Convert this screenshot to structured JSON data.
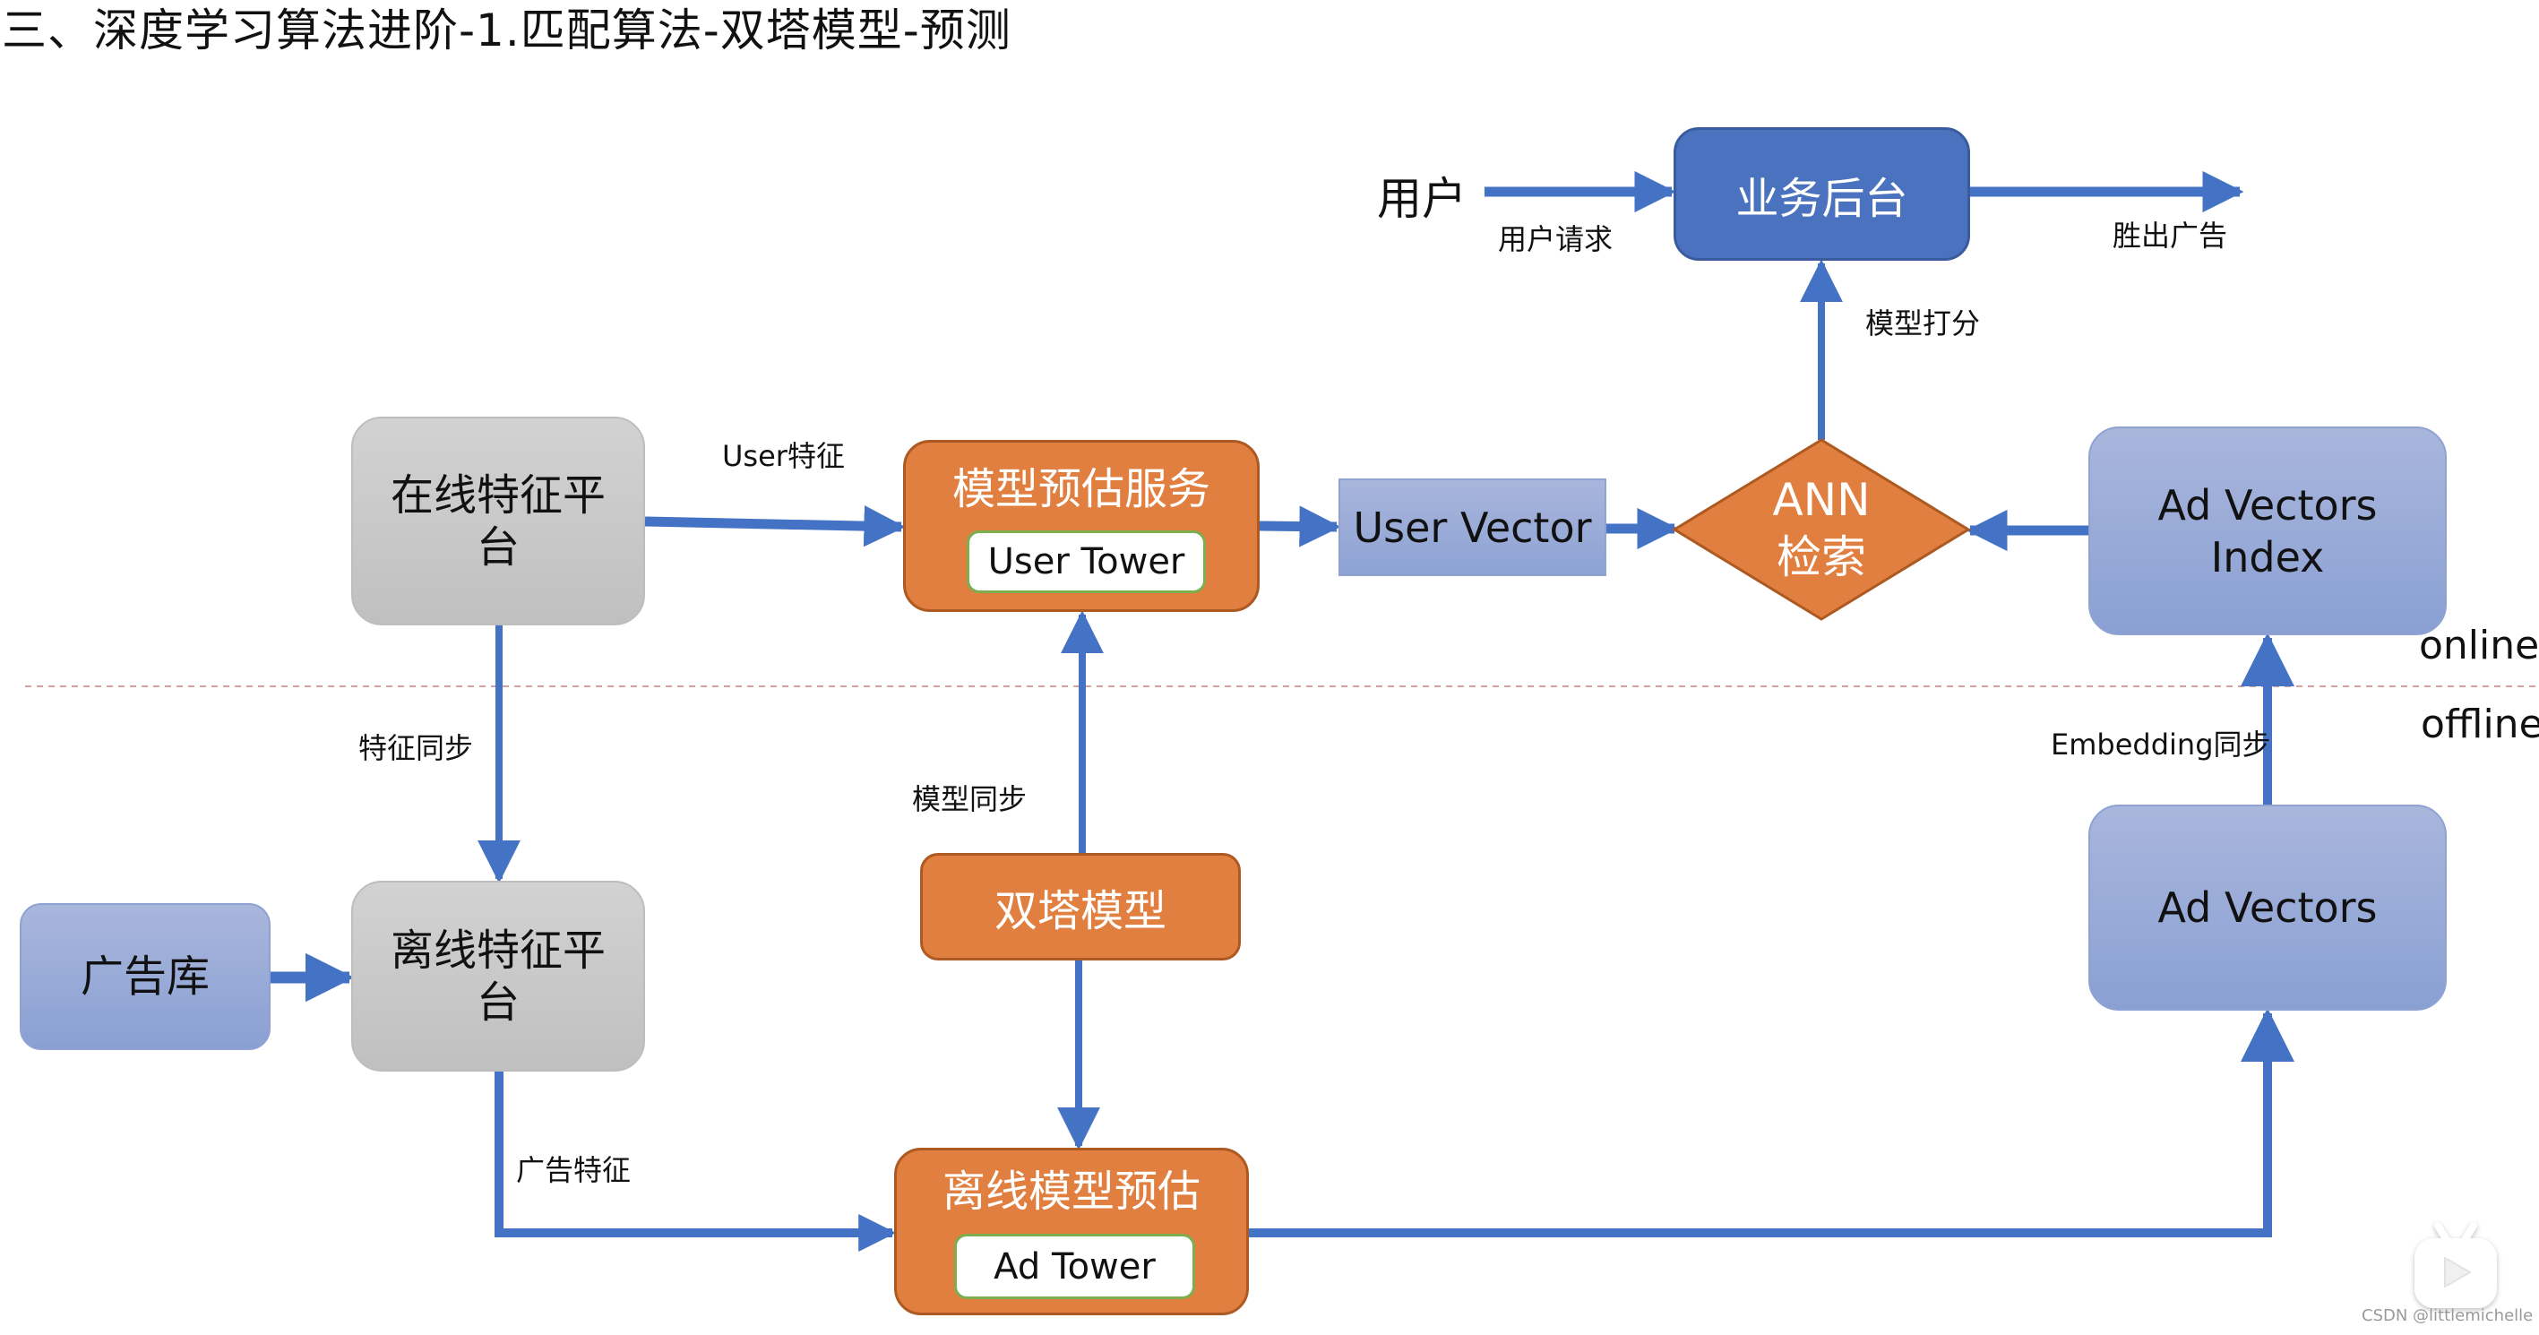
{
  "title": "三、深度学习算法进阶-1.匹配算法-双塔模型-预测",
  "colors": {
    "arrow": "#4472c4",
    "orange": "#e07f3f",
    "dark_blue": "#4a72be",
    "light_blue": "#97a9d8",
    "gray": "#c8c8c8",
    "divider": "#d9a0a0"
  },
  "nodes": {
    "user": "用户",
    "business_backend": "业务后台",
    "online_feature_platform": "在线特征平台",
    "model_serving": "模型预估服务",
    "user_tower": "User Tower",
    "user_vector": "User Vector",
    "ann_line1": "ANN",
    "ann_line2": "检索",
    "ad_vectors_index_line1": "Ad Vectors",
    "ad_vectors_index_line2": "Index",
    "ad_library": "广告库",
    "offline_feature_platform": "离线特征平台",
    "two_tower_model": "双塔模型",
    "offline_model_prediction": "离线模型预估",
    "ad_tower": "Ad Tower",
    "ad_vectors": "Ad Vectors"
  },
  "edge_labels": {
    "user_request": "用户请求",
    "winning_ads": "胜出广告",
    "model_scoring": "模型打分",
    "user_features": "User特征",
    "feature_sync": "特征同步",
    "model_sync": "模型同步",
    "embedding_sync": "Embedding同步",
    "ad_features": "广告特征"
  },
  "zones": {
    "online": "online",
    "offline": "offline"
  },
  "watermark": {
    "icon": "tv-play-icon",
    "text": "CSDN @littlemichelle"
  }
}
